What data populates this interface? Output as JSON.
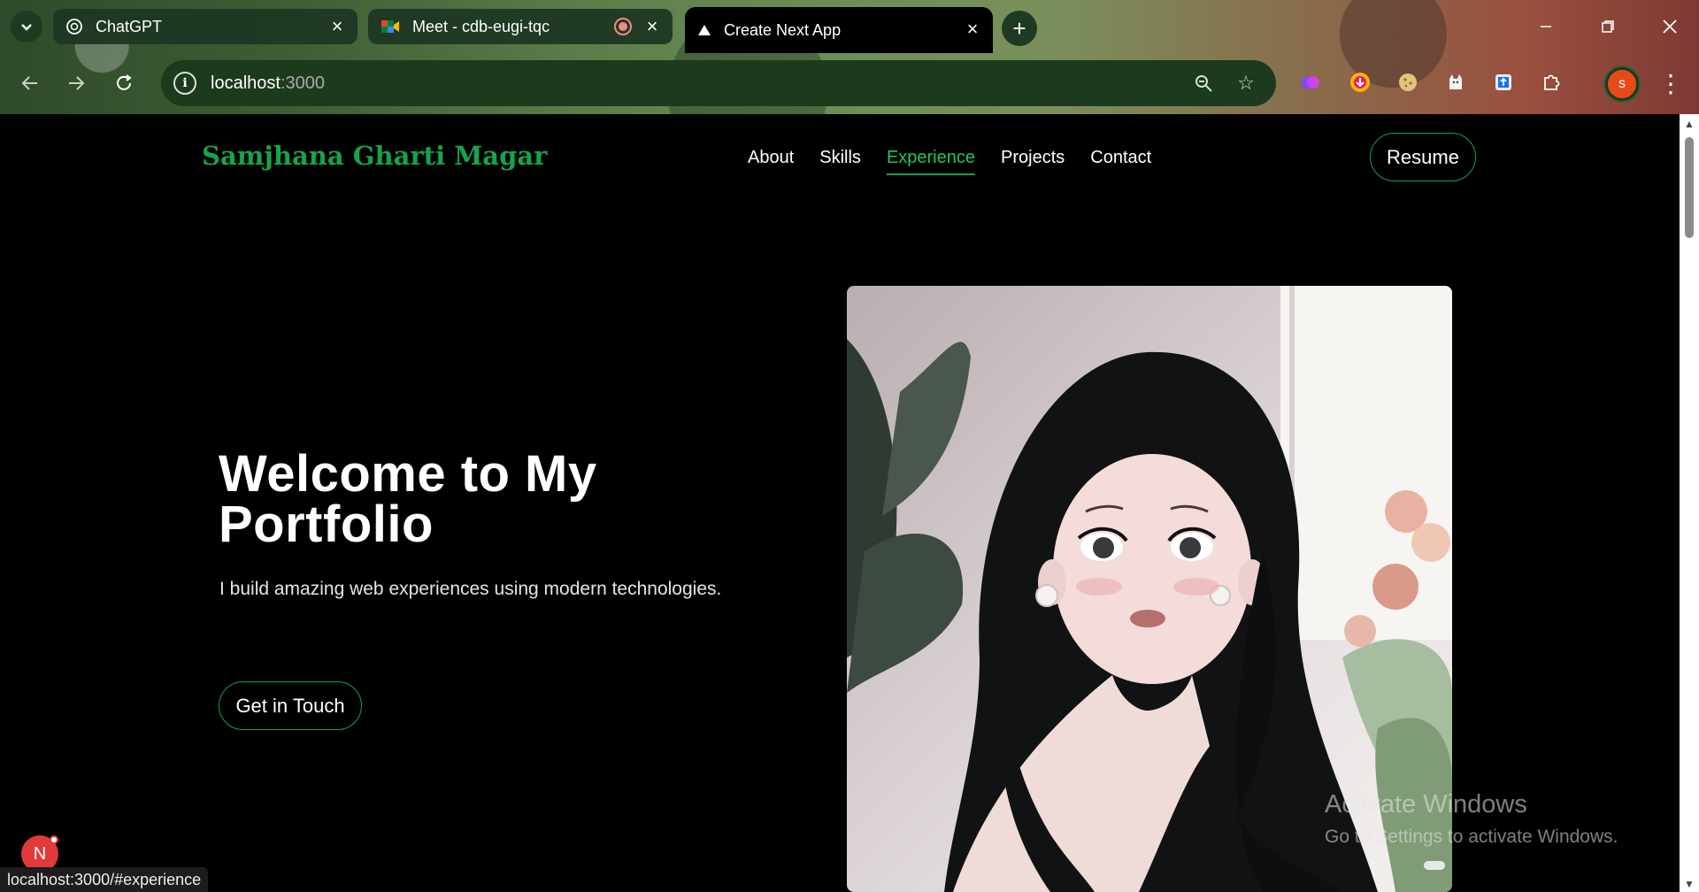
{
  "browser": {
    "tabs": [
      {
        "title": "ChatGPT",
        "icon": "chatgpt-icon"
      },
      {
        "title": "Meet - cdb-eugi-tqc",
        "icon": "google-meet-icon",
        "recording": true
      },
      {
        "title": "Create Next App",
        "icon": "vercel-icon",
        "active": true
      }
    ],
    "url_host": "localhost",
    "url_port": ":3000",
    "profile_initial": "s",
    "extensions": [
      "brain-extension-icon",
      "download-extension-icon",
      "cookie-extension-icon",
      "cat-extension-icon",
      "upload-extension-icon",
      "puzzle-icon"
    ]
  },
  "site": {
    "brand": "Samjhana Gharti Magar",
    "nav": [
      {
        "label": "About",
        "active": false
      },
      {
        "label": "Skills",
        "active": false
      },
      {
        "label": "Experience",
        "active": true
      },
      {
        "label": "Projects",
        "active": false
      },
      {
        "label": "Contact",
        "active": false
      }
    ],
    "resume_label": "Resume",
    "hero_title": "Welcome to My Portfolio",
    "hero_subtitle": "I build amazing web experiences using modern technologies.",
    "cta_label": "Get in Touch"
  },
  "overlays": {
    "watermark_title": "Activate Windows",
    "watermark_sub": "Go to Settings to activate Windows.",
    "next_badge": "N",
    "status_url": "localhost:3000/#experience"
  },
  "colors": {
    "accent": "#16a34a",
    "accent_light": "#22c55e",
    "page_bg": "#000000"
  }
}
